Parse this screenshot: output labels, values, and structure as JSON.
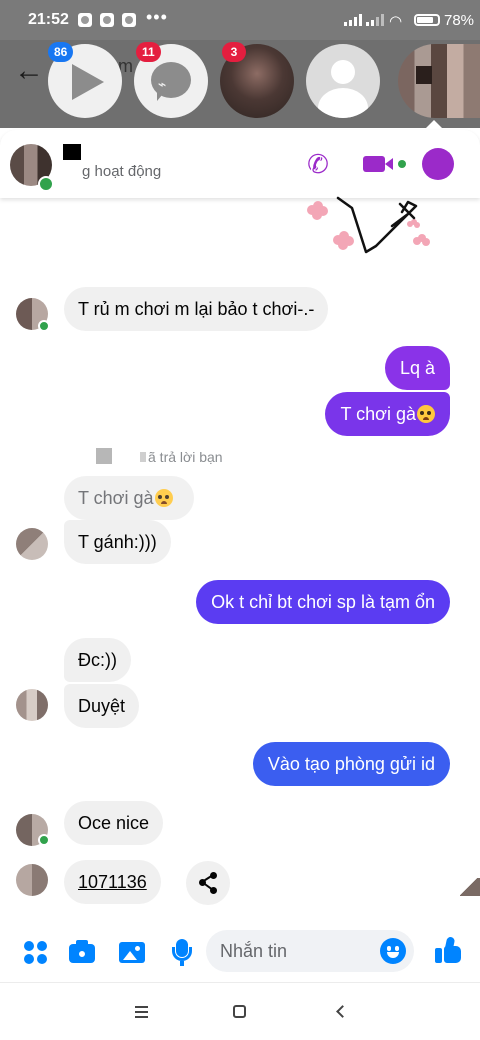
{
  "status_bar": {
    "time": "21:52",
    "overflow": "•••",
    "battery_percent": "78%",
    "battery_level": 0.78
  },
  "chat_heads": [
    {
      "name": "play",
      "badge": "86"
    },
    {
      "name": "messenger",
      "badge": "11"
    },
    {
      "name": "photo-contact",
      "badge": "3"
    },
    {
      "name": "default-user",
      "badge": ""
    },
    {
      "name": "pixelated-contact",
      "badge": ""
    }
  ],
  "chat_header": {
    "status_text": "g hoạt động",
    "call_icon": "phone-icon",
    "video_icon": "video-camera-icon",
    "info_icon": "info-icon",
    "accent_color": "#9b2ac9"
  },
  "messages": {
    "m1": "T rủ m chơi m lại bảo t chơi-.-",
    "m2": "Lq à",
    "m3": "T chơi gà",
    "reply_meta": "ã trả lời bạn",
    "m4_quoted": "T chơi gà",
    "m5": "T gánh:)))",
    "m6": "Ok t chỉ bt chơi sp là tạm ổn",
    "m7": "Đc:))",
    "m8": "Duyệt",
    "m9": "Vào tạo phòng gửi id",
    "m10": "Oce nice",
    "m11": "1071136"
  },
  "colors": {
    "outgoing_purple": "#8a33e8",
    "outgoing_indigo": "#5b3cf2",
    "outgoing_blue": "#3b5ef0",
    "incoming_gray": "#f0f0f0",
    "online_green": "#31a24c",
    "composer_blue": "#0084ff"
  },
  "composer": {
    "placeholder": "Nhắn tin"
  }
}
